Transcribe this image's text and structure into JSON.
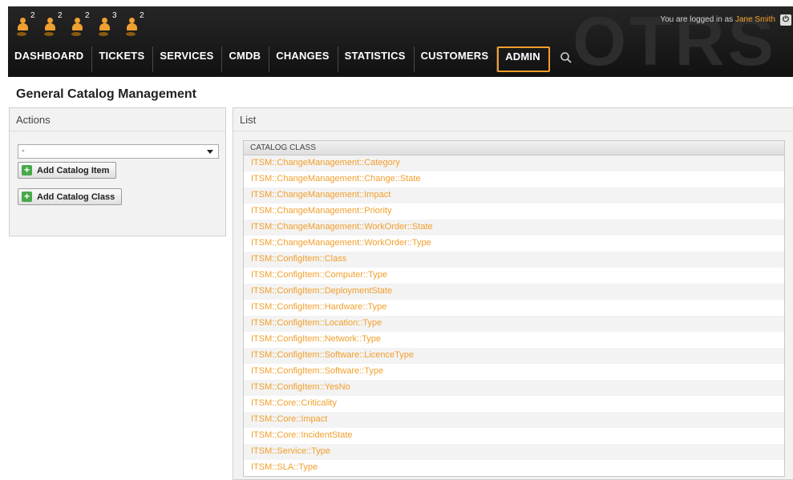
{
  "header": {
    "logo_text": "OTRS",
    "login_prefix": "You are logged in as",
    "user_name": "Jane Smith",
    "toolbar_counts": [
      "2",
      "2",
      "2",
      "3",
      "2"
    ]
  },
  "nav": {
    "items": [
      {
        "label": "DASHBOARD"
      },
      {
        "label": "TICKETS"
      },
      {
        "label": "SERVICES"
      },
      {
        "label": "CMDB"
      },
      {
        "label": "CHANGES"
      },
      {
        "label": "STATISTICS"
      },
      {
        "label": "CUSTOMERS"
      },
      {
        "label": "ADMIN",
        "active": true
      }
    ]
  },
  "page": {
    "title": "General Catalog Management"
  },
  "actions": {
    "title": "Actions",
    "select_value": "-",
    "add_item_label": "Add Catalog Item",
    "add_class_label": "Add Catalog Class"
  },
  "list": {
    "title": "List",
    "column_header": "CATALOG CLASS",
    "rows": [
      "ITSM::ChangeManagement::Category",
      "ITSM::ChangeManagement::Change::State",
      "ITSM::ChangeManagement::Impact",
      "ITSM::ChangeManagement::Priority",
      "ITSM::ChangeManagement::WorkOrder::State",
      "ITSM::ChangeManagement::WorkOrder::Type",
      "ITSM::ConfigItem::Class",
      "ITSM::ConfigItem::Computer::Type",
      "ITSM::ConfigItem::DeploymentState",
      "ITSM::ConfigItem::Hardware::Type",
      "ITSM::ConfigItem::Location::Type",
      "ITSM::ConfigItem::Network::Type",
      "ITSM::ConfigItem::Software::LicenceType",
      "ITSM::ConfigItem::Software::Type",
      "ITSM::ConfigItem::YesNo",
      "ITSM::Core::Criticality",
      "ITSM::Core::Impact",
      "ITSM::Core::IncidentState",
      "ITSM::Service::Type",
      "ITSM::SLA::Type"
    ]
  },
  "colors": {
    "accent": "#f29f2b",
    "header_bg": "#1e1e1e",
    "add_icon": "#48a94a"
  }
}
